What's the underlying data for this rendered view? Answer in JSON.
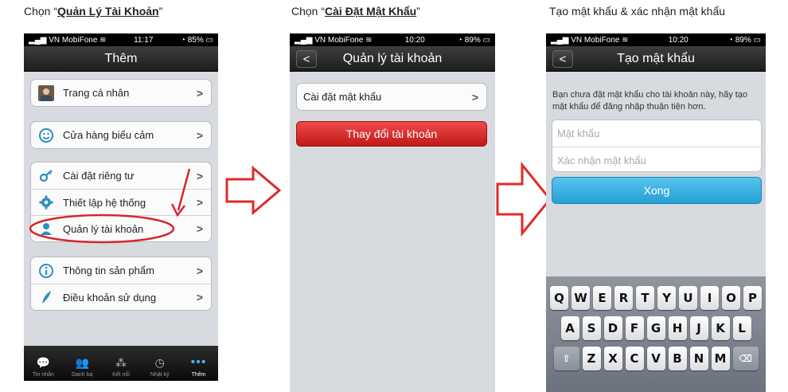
{
  "captions": {
    "step1_prefix": "Chọn “",
    "step1_bold": "Quản Lý Tài Khoản",
    "step1_suffix": "”",
    "step2_prefix": "Chọn “",
    "step2_bold": "Cài Đặt Mật Khẩu",
    "step2_suffix": "”",
    "step3": "Tạo mật khẩu & xác nhận mật khẩu"
  },
  "screen1": {
    "status": {
      "carrier": "VN MobiFone",
      "time": "11:17",
      "battery": "85%"
    },
    "title": "Thêm",
    "groups": [
      [
        {
          "label": "Trang cá nhân",
          "icon": "avatar-icon"
        }
      ],
      [
        {
          "label": "Cửa hàng biểu cảm",
          "icon": "smiley-icon"
        }
      ],
      [
        {
          "label": "Cài đặt riêng tư",
          "icon": "key-icon"
        },
        {
          "label": "Thiết lập hệ thống",
          "icon": "gear-icon"
        },
        {
          "label": "Quản lý tài khoản",
          "icon": "user-icon"
        }
      ],
      [
        {
          "label": "Thông tin sản phẩm",
          "icon": "info-icon"
        },
        {
          "label": "Điều khoản sử dụng",
          "icon": "feather-icon"
        }
      ]
    ],
    "tabs": [
      {
        "label": "Tin nhắn",
        "icon": "chat-icon"
      },
      {
        "label": "Danh bạ",
        "icon": "contacts-icon"
      },
      {
        "label": "Kết nối",
        "icon": "connect-icon"
      },
      {
        "label": "Nhật ký",
        "icon": "clock-icon"
      },
      {
        "label": "Thêm",
        "icon": "more-icon",
        "active": true
      }
    ]
  },
  "screen2": {
    "status": {
      "carrier": "VN MobiFone",
      "time": "10:20",
      "battery": "89%"
    },
    "title": "Quản lý tài khoản",
    "row_label": "Cài đặt mật khẩu",
    "change_account": "Thay đổi tài khoản"
  },
  "screen3": {
    "status": {
      "carrier": "VN MobiFone",
      "time": "10:20",
      "battery": "89%"
    },
    "title": "Tạo mật khẩu",
    "info": "Bạn chưa đặt mật khẩu cho tài khoản này, hãy tạo mật khẩu để đăng nhập thuận tiện hơn.",
    "password_placeholder": "Mật khẩu",
    "confirm_placeholder": "Xác nhận mật khẩu",
    "done": "Xong",
    "keyboard": {
      "row1": [
        "Q",
        "W",
        "E",
        "R",
        "T",
        "Y",
        "U",
        "I",
        "O",
        "P"
      ],
      "row2": [
        "A",
        "S",
        "D",
        "F",
        "G",
        "H",
        "J",
        "K",
        "L"
      ],
      "row3": [
        "Z",
        "X",
        "C",
        "V",
        "B",
        "N",
        "M"
      ]
    }
  },
  "colors": {
    "highlight": "#d6262b",
    "arrow": "#e02a2a",
    "done": "#2aa5da",
    "danger": "#d62222"
  }
}
